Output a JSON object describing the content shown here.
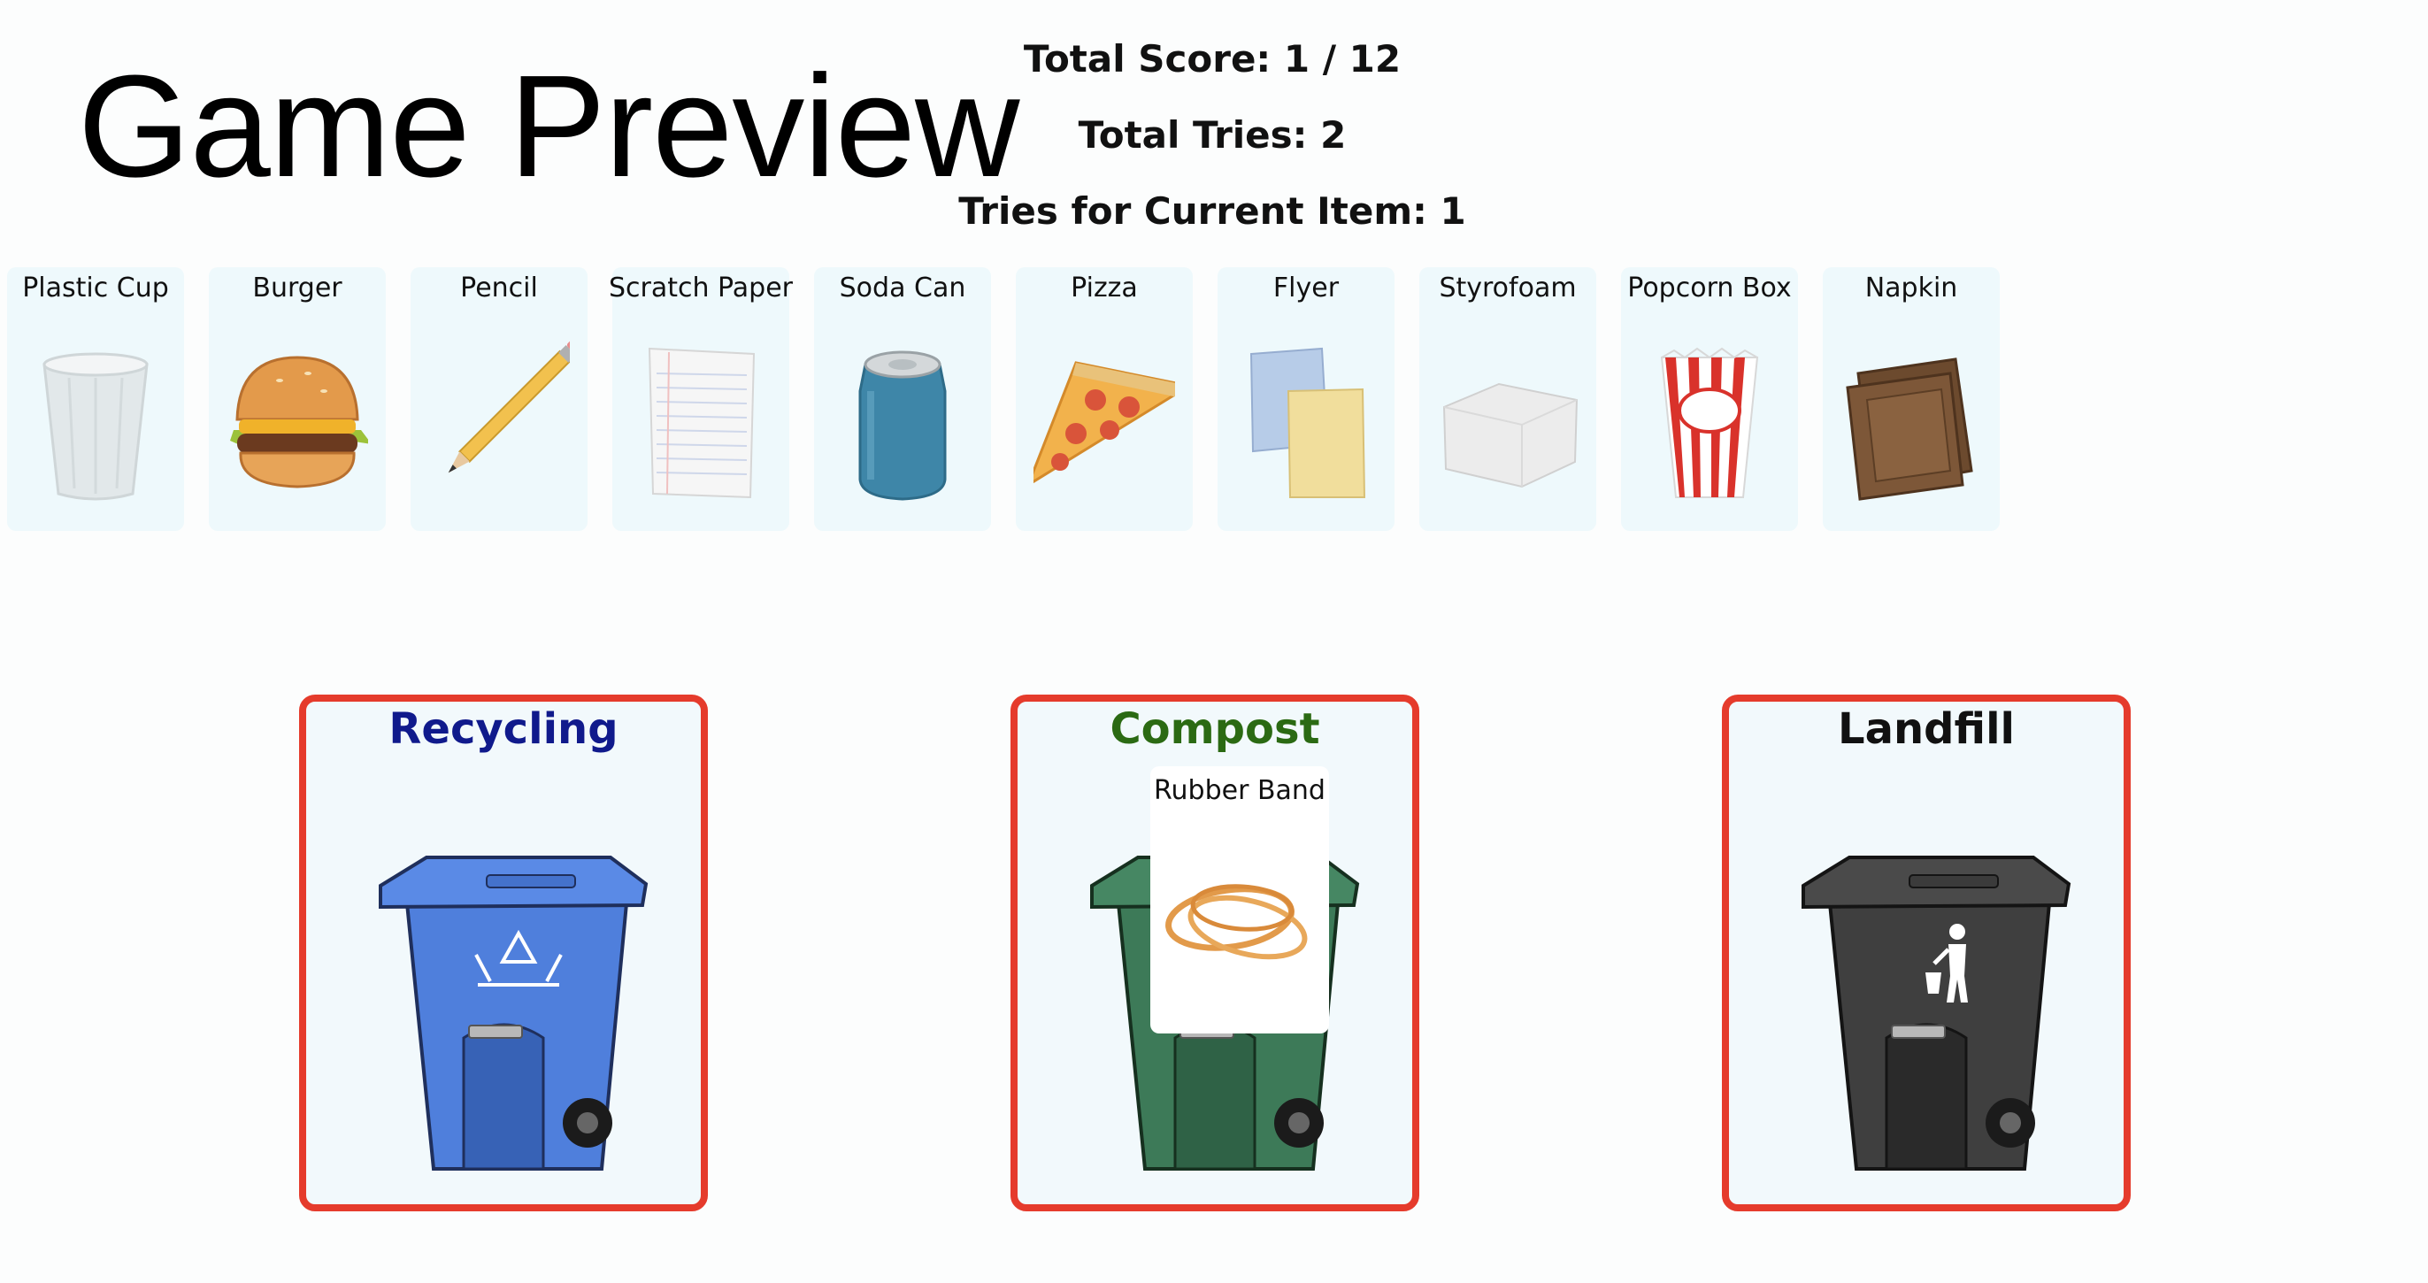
{
  "page": {
    "title": "Game Preview"
  },
  "stats": {
    "score": "Total Score: 1 / 12",
    "tries": "Total Tries: 2",
    "current_tries": "Tries for Current Item: 1"
  },
  "items": [
    {
      "label": "Plastic Cup",
      "icon": "plastic-cup-icon"
    },
    {
      "label": "Burger",
      "icon": "burger-icon"
    },
    {
      "label": "Pencil",
      "icon": "pencil-icon"
    },
    {
      "label": "Scratch Paper",
      "icon": "scratch-paper-icon"
    },
    {
      "label": "Soda Can",
      "icon": "soda-can-icon"
    },
    {
      "label": "Pizza",
      "icon": "pizza-icon"
    },
    {
      "label": "Flyer",
      "icon": "flyer-icon"
    },
    {
      "label": "Styrofoam",
      "icon": "styrofoam-icon"
    },
    {
      "label": "Popcorn Box",
      "icon": "popcorn-box-icon"
    },
    {
      "label": "Napkin",
      "icon": "napkin-icon"
    }
  ],
  "bins": [
    {
      "label": "Recycling",
      "color": "#101a8c",
      "bin_color": "#4f7fdc",
      "icon": "recycle-icon"
    },
    {
      "label": "Compost",
      "color": "#2b6a13",
      "bin_color": "#3d7a58",
      "icon": "leaf-icon"
    },
    {
      "label": "Landfill",
      "color": "#111111",
      "bin_color": "#3f3f3f",
      "icon": "trash-person-icon"
    }
  ],
  "dragging_item": {
    "label": "Rubber Band",
    "icon": "rubber-band-icon"
  },
  "colors": {
    "bin_border": "#e53b2c",
    "card_bg": "#eef9fc"
  }
}
